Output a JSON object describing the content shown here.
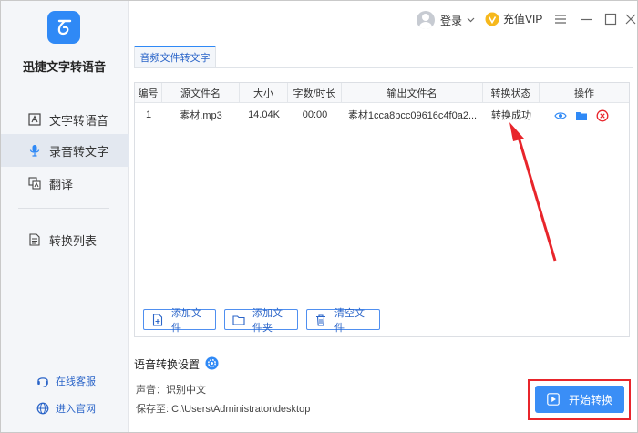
{
  "app": {
    "name": "迅捷文字转语音"
  },
  "sidebar": {
    "items": [
      {
        "label": "文字转语音",
        "icon": "text-to-speech-icon"
      },
      {
        "label": "录音转文字",
        "icon": "microphone-icon",
        "active": true
      },
      {
        "label": "翻译",
        "icon": "translate-icon"
      },
      {
        "label": "转换列表",
        "icon": "convert-list-icon"
      }
    ],
    "footer": [
      {
        "label": "在线客服",
        "icon": "headset-icon"
      },
      {
        "label": "进入官网",
        "icon": "globe-icon"
      }
    ]
  },
  "titlebar": {
    "login_label": "登录",
    "vip_label": "充值VIP"
  },
  "tab": {
    "label": "音频文件转文字"
  },
  "table": {
    "headers": [
      "编号",
      "源文件名",
      "大小",
      "字数/时长",
      "输出文件名",
      "转换状态",
      "操作"
    ],
    "rows": [
      {
        "index": "1",
        "source": "素材.mp3",
        "size": "14.04K",
        "duration": "00:00",
        "output": "素材1cca8bcc09616c4f0a2...",
        "status": "转换成功",
        "actions": [
          "view-icon",
          "open-folder-icon",
          "delete-icon"
        ]
      }
    ]
  },
  "panel_buttons": {
    "add_file": "添加文件",
    "add_folder": "添加文件夹",
    "clear_files": "清空文件"
  },
  "settings": {
    "title": "语音转换设置",
    "voice_label": "声音：",
    "voice_value": "识别中文",
    "save_label": "保存至:",
    "save_value": "C:\\Users\\Administrator\\desktop"
  },
  "start_button": {
    "label": "开始转换"
  },
  "colors": {
    "accent": "#2f89f6",
    "highlight": "#e8252b",
    "sidebar_bg": "#f4f6f9"
  }
}
